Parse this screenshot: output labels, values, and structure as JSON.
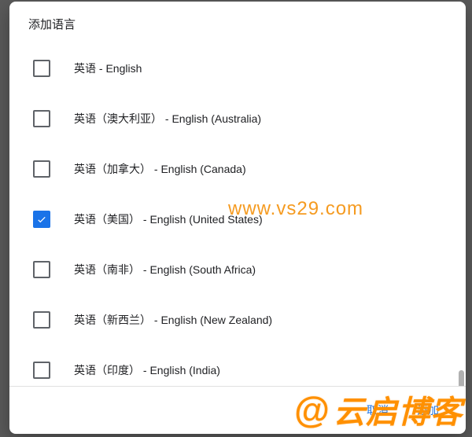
{
  "dialog": {
    "title": "添加语言",
    "buttons": {
      "cancel": "取消",
      "confirm": "添加"
    }
  },
  "languages": [
    {
      "label": "英语 - English",
      "checked": false
    },
    {
      "label": "英语（澳大利亚） - English (Australia)",
      "checked": false
    },
    {
      "label": "英语（加拿大） - English (Canada)",
      "checked": false
    },
    {
      "label": "英语（美国） - English (United States)",
      "checked": true
    },
    {
      "label": "英语（南非） - English (South Africa)",
      "checked": false
    },
    {
      "label": "英语（新西兰） - English (New Zealand)",
      "checked": false
    },
    {
      "label": "英语（印度） - English (India)",
      "checked": false
    }
  ],
  "watermarks": {
    "url": "www.vs29.com",
    "brand": "@云启博客"
  }
}
